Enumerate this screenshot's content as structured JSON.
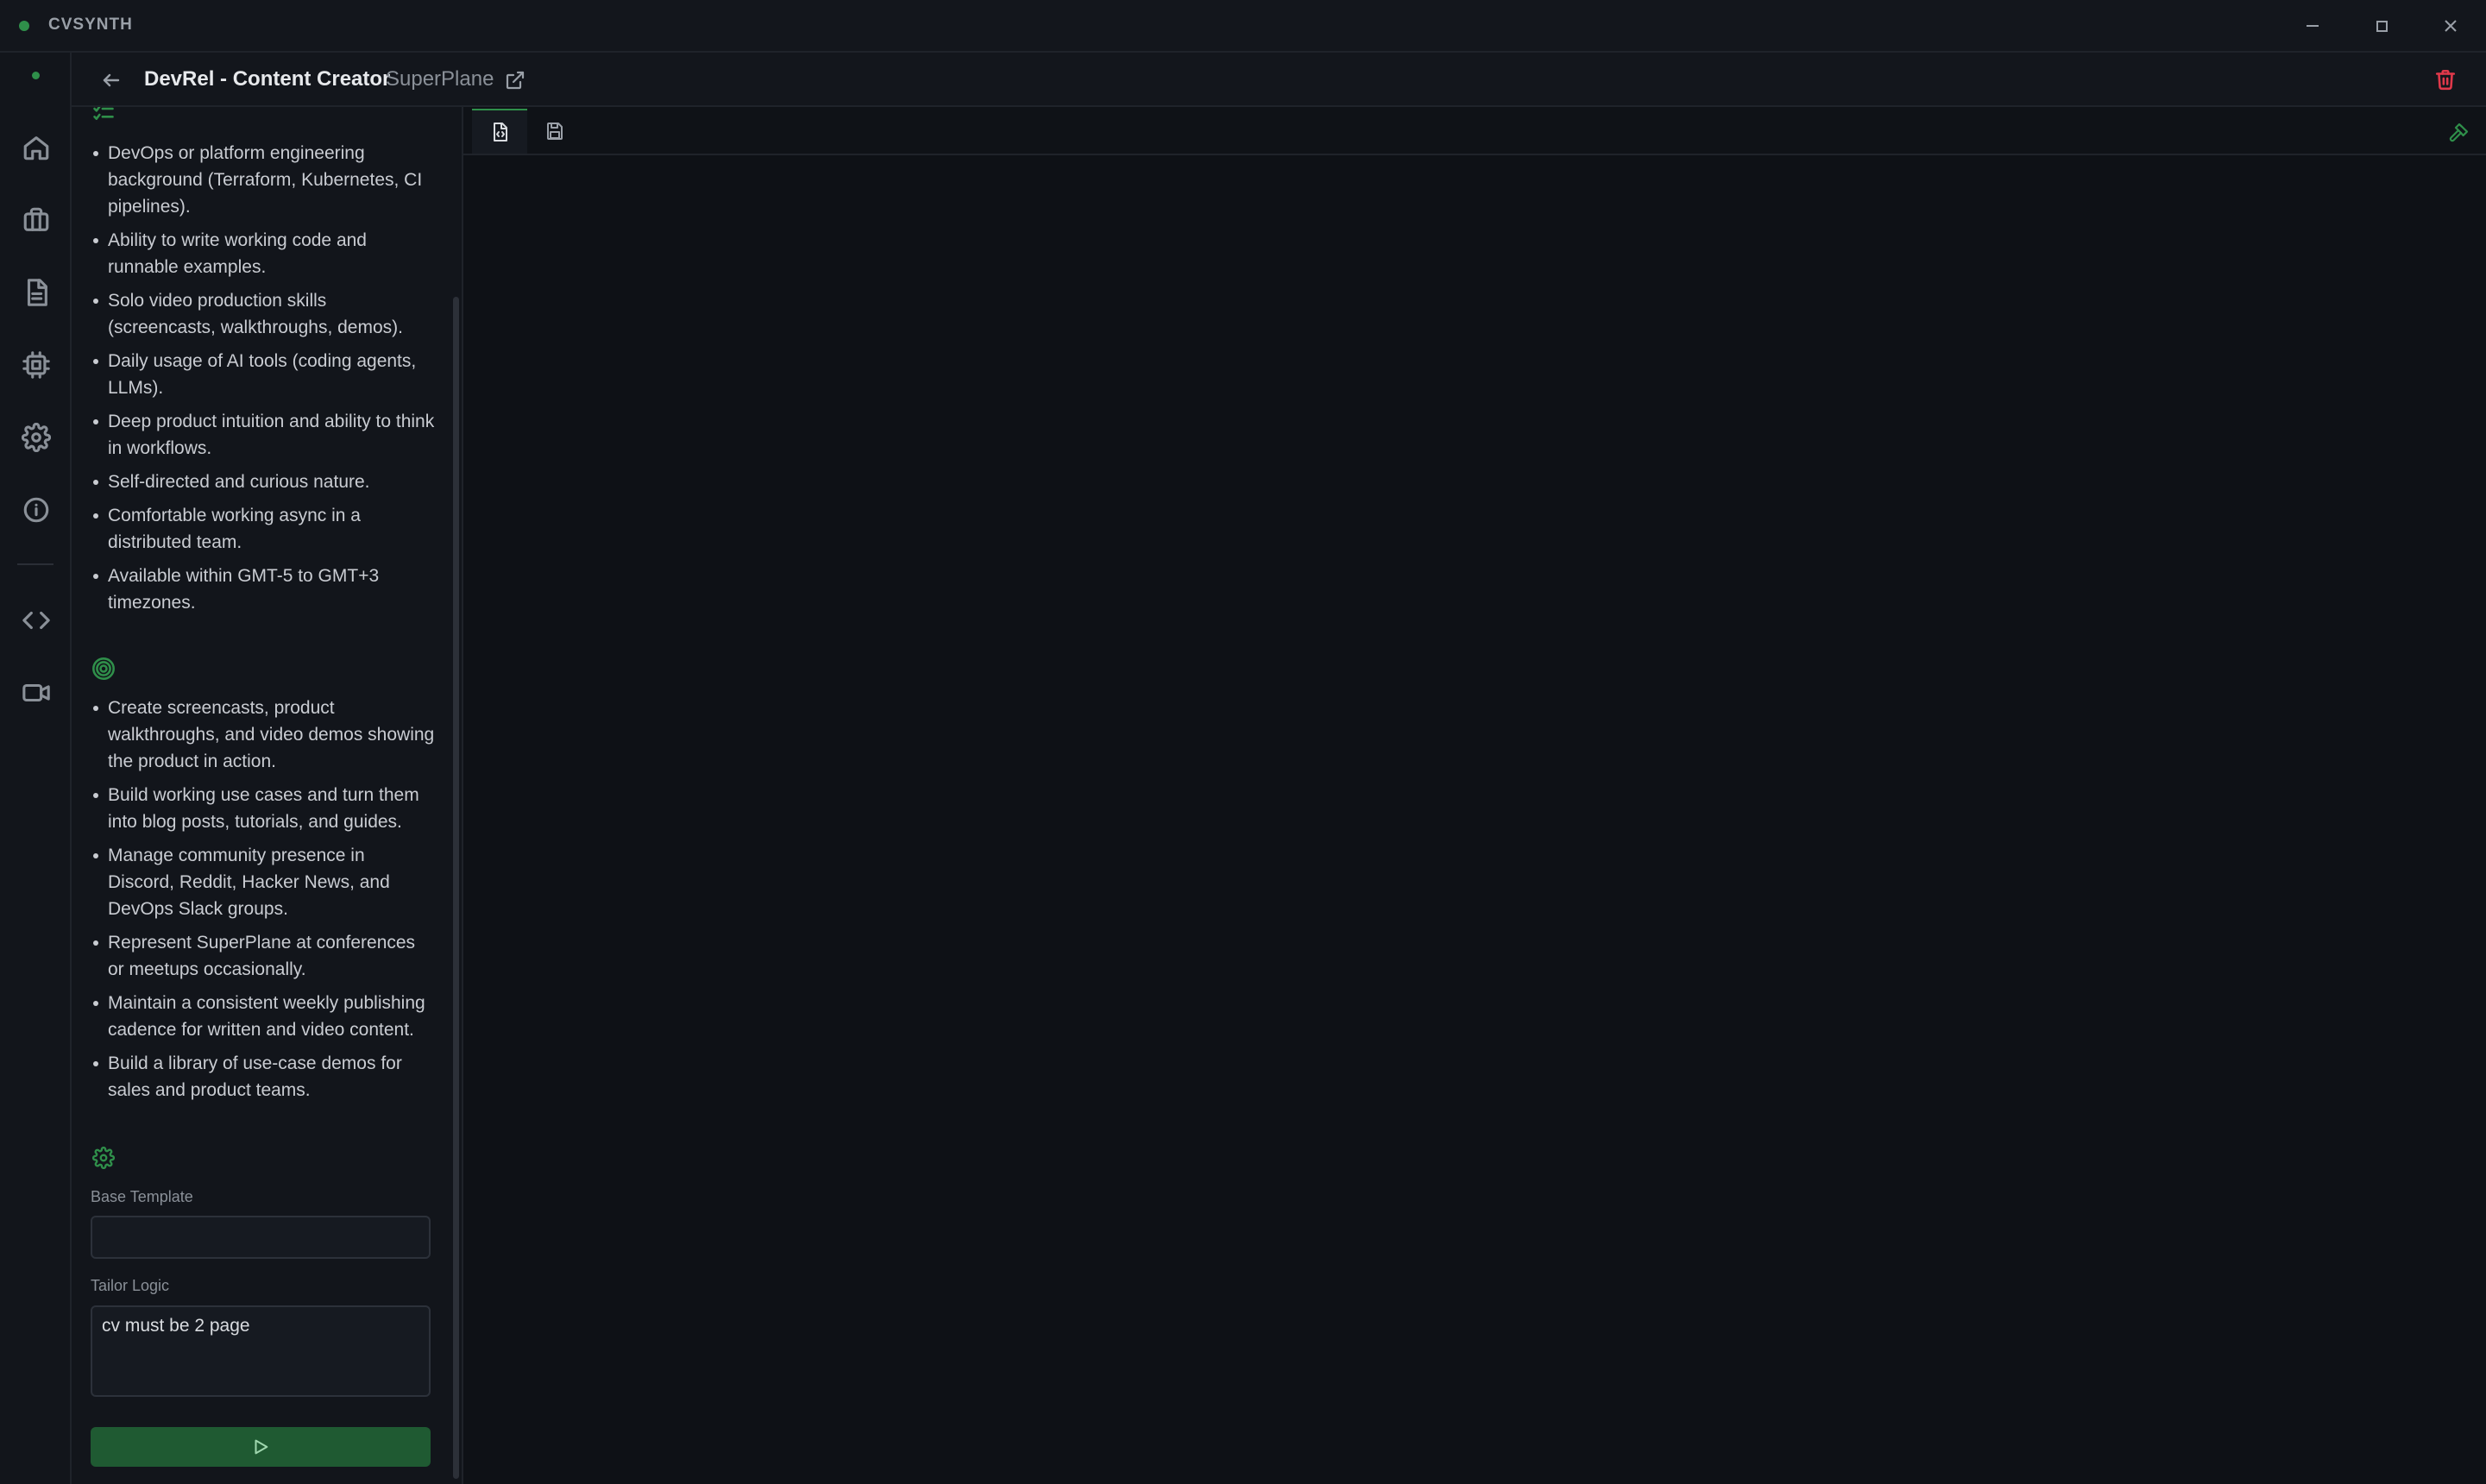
{
  "app": {
    "title": "CVSYNTH"
  },
  "header": {
    "title": "DevRel - Content Creator",
    "company": "SuperPlane"
  },
  "requirements": {
    "icon": "checklist-icon",
    "items": [
      "DevOps or platform engineering background (Terraform, Kubernetes, CI pipelines).",
      "Ability to write working code and runnable examples.",
      "Solo video production skills (screencasts, walkthroughs, demos).",
      "Daily usage of AI tools (coding agents, LLMs).",
      "Deep product intuition and ability to think in workflows.",
      "Self-directed and curious nature.",
      "Comfortable working async in a distributed team.",
      "Available within GMT-5 to GMT+3 timezones."
    ]
  },
  "responsibilities": {
    "icon": "target-icon",
    "items": [
      "Create screencasts, product walkthroughs, and video demos showing the product in action.",
      "Build working use cases and turn them into blog posts, tutorials, and guides.",
      "Manage community presence in Discord, Reddit, Hacker News, and DevOps Slack groups.",
      "Represent SuperPlane at conferences or meetups occasionally.",
      "Maintain a consistent weekly publishing cadence for written and video content.",
      "Build a library of use-case demos for sales and product teams."
    ]
  },
  "settings": {
    "icon": "gear-icon",
    "base_template_label": "Base Template",
    "base_template_value": "",
    "tailor_logic_label": "Tailor Logic",
    "tailor_logic_value": "cv must be 2 page"
  },
  "colors": {
    "accent": "#2f8f4a",
    "danger": "#e0384a",
    "background": "#0e1116"
  }
}
